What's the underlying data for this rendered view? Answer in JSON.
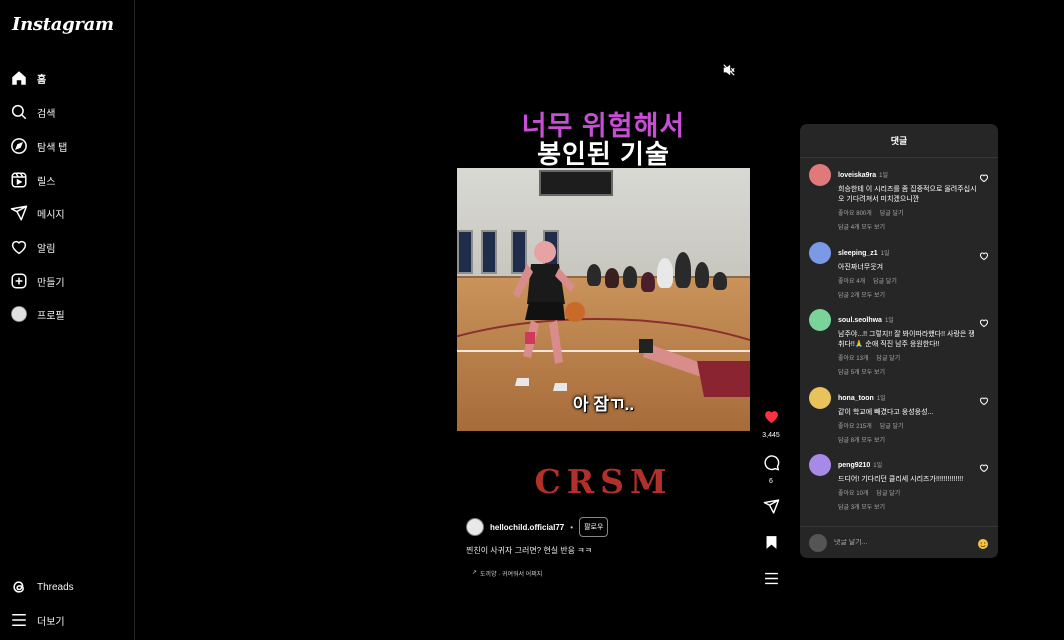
{
  "app": {
    "logo": "Instagram"
  },
  "sidebar": {
    "items": [
      {
        "label": "홈",
        "icon": "home-icon"
      },
      {
        "label": "검색",
        "icon": "search-icon"
      },
      {
        "label": "탐색 탭",
        "icon": "compass-icon"
      },
      {
        "label": "릴스",
        "icon": "reels-icon"
      },
      {
        "label": "메시지",
        "icon": "send-icon"
      },
      {
        "label": "알림",
        "icon": "heart-icon"
      },
      {
        "label": "만들기",
        "icon": "plus-square-icon"
      },
      {
        "label": "프로필",
        "icon": "avatar-icon"
      }
    ],
    "bottom": [
      {
        "label": "Threads",
        "icon": "threads-icon"
      },
      {
        "label": "더보기",
        "icon": "menu-icon"
      }
    ]
  },
  "reel": {
    "title_line1": "너무 위험해서",
    "title_line2": "봉인된 기술",
    "subtitle": "아 잠ㄲ..",
    "brand": "CRSM",
    "author": "hellochild.official77",
    "separator": "•",
    "follow_label": "팔로우",
    "caption": "찐친이 사귀자 그러면? 현실 반응 ㅋㅋ",
    "audio_arrow": "↗",
    "audio": "도끼양 · 귀여워서 어쩌지",
    "colors": {
      "title_accent": "#c64fd4",
      "brand": "#b2302a",
      "like": "#ff3040"
    }
  },
  "actions": {
    "likes": "3,445",
    "comments": "6"
  },
  "comments_panel": {
    "title": "댓글",
    "input_placeholder": "댓글 달기...",
    "items": [
      {
        "user": "loveiska9ra",
        "time": "1일",
        "text": "희승한테 이 시리즈를 좀 집중적으로 올려주십시오 기다려져서 미치겠으니깐",
        "likes": "좋아요 800개",
        "reply": "답글 달기",
        "replies": "답글 4개 모두 보기",
        "avatar_color": "#e07a7a"
      },
      {
        "user": "sleeping_z1",
        "time": "1일",
        "text": "아진짜너무웃겨",
        "likes": "좋아요 4개",
        "reply": "답글 달기",
        "replies": "답글 2개 모두 보기",
        "avatar_color": "#7a9ae8"
      },
      {
        "user": "soul.seolhwa",
        "time": "1일",
        "text": "남주야...!! 그렇지!! 잘 봐이따라했다!! 사랑은 쟁취다!!🙏 순애 직진 남주 응원한다!!",
        "likes": "좋아요 13개",
        "reply": "답글 달기",
        "replies": "답글 5개 모두 보기",
        "avatar_color": "#7ad49a"
      },
      {
        "user": "hona_toon",
        "time": "1일",
        "text": "같이 학교에 빼겼다고 웅성웅성...",
        "likes": "좋아요 215개",
        "reply": "답글 달기",
        "replies": "답글 8개 모두 보기",
        "avatar_color": "#e8c25a"
      },
      {
        "user": "peng9210",
        "time": "1일",
        "text": "드디어! 기다리던 클리세 시리즈가!!!!!!!!!!!!!!",
        "likes": "좋아요 10개",
        "reply": "답글 달기",
        "replies": "답글 3개 모두 보기",
        "avatar_color": "#a78ae8"
      }
    ]
  }
}
